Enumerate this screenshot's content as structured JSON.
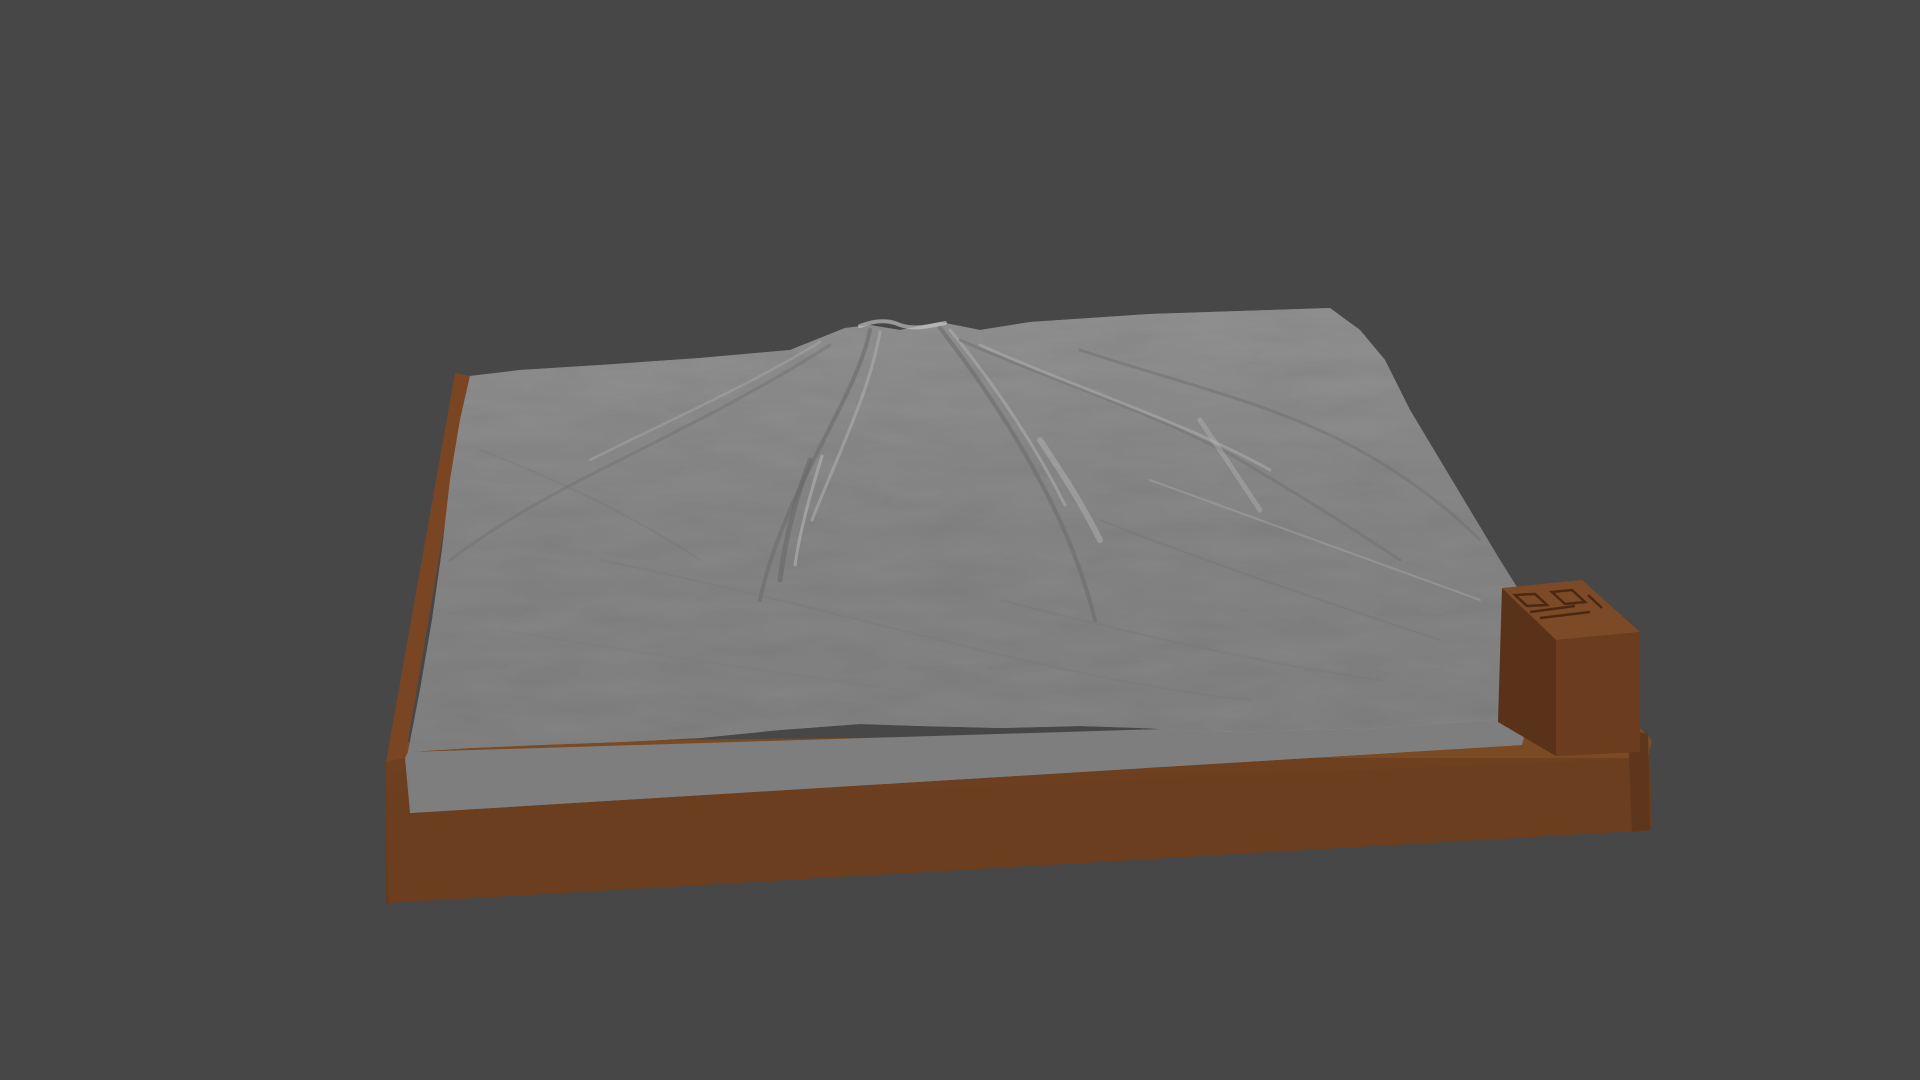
{
  "scene": {
    "background_color": "#474747",
    "terrain_color": "#8d8d8d",
    "terrain_side_color": "#7f7f7f",
    "base_color": "#6a3e1f",
    "base_top_color": "#7a4a25",
    "base_shadow_color": "#5c341a",
    "objects": {
      "terrain": "terrain-relief-model",
      "base": "wooden-base-frame",
      "marker": "compass-marker-block"
    }
  }
}
